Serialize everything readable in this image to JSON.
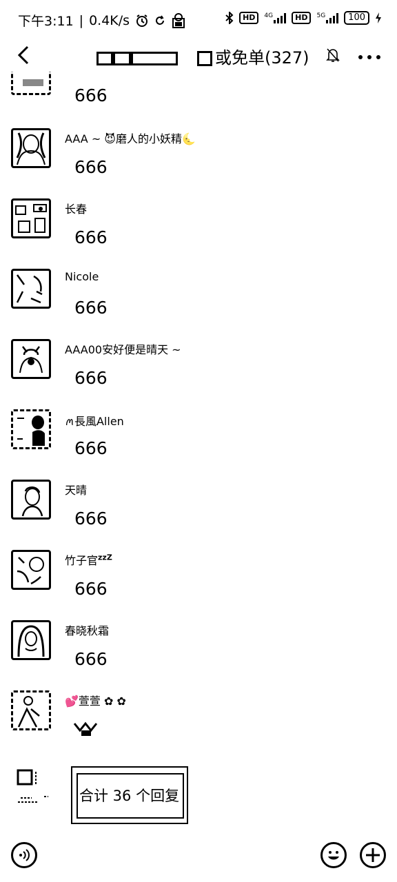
{
  "status_bar": {
    "time": "下午3:11",
    "separator": "|",
    "speed": "0.4K/s",
    "hd1": "HD",
    "net1": "4G",
    "hd2": "HD",
    "net2": "5G",
    "battery": "100"
  },
  "nav": {
    "title": "或免单(327)",
    "back_icon": "chevron-left-icon",
    "mute_icon": "bell-off-icon",
    "more_icon": "more-icon"
  },
  "messages": [
    {
      "sender": "",
      "text": "666"
    },
    {
      "sender": "AAA ~ 😈磨人的小妖精🌜",
      "text": "666"
    },
    {
      "sender": "长春",
      "text": "666"
    },
    {
      "sender": "Nicole",
      "text": "666"
    },
    {
      "sender": "AAA00安好便是晴天 ~",
      "text": "666"
    },
    {
      "sender": "ꪔ長風Allen",
      "text": "666"
    },
    {
      "sender": "天晴",
      "text": "666"
    },
    {
      "sender": "竹子官",
      "sender_suffix": "zzZ",
      "text": "666"
    },
    {
      "sender": "春晓秋霜",
      "text": "666"
    },
    {
      "sender": "💕萱萱 ✿ ✿",
      "text": ""
    }
  ],
  "reply": {
    "label": "合计 36 个回复"
  },
  "input_bar": {
    "voice_icon": "voice-icon",
    "emoji_icon": "emoji-icon",
    "add_icon": "plus-icon"
  }
}
